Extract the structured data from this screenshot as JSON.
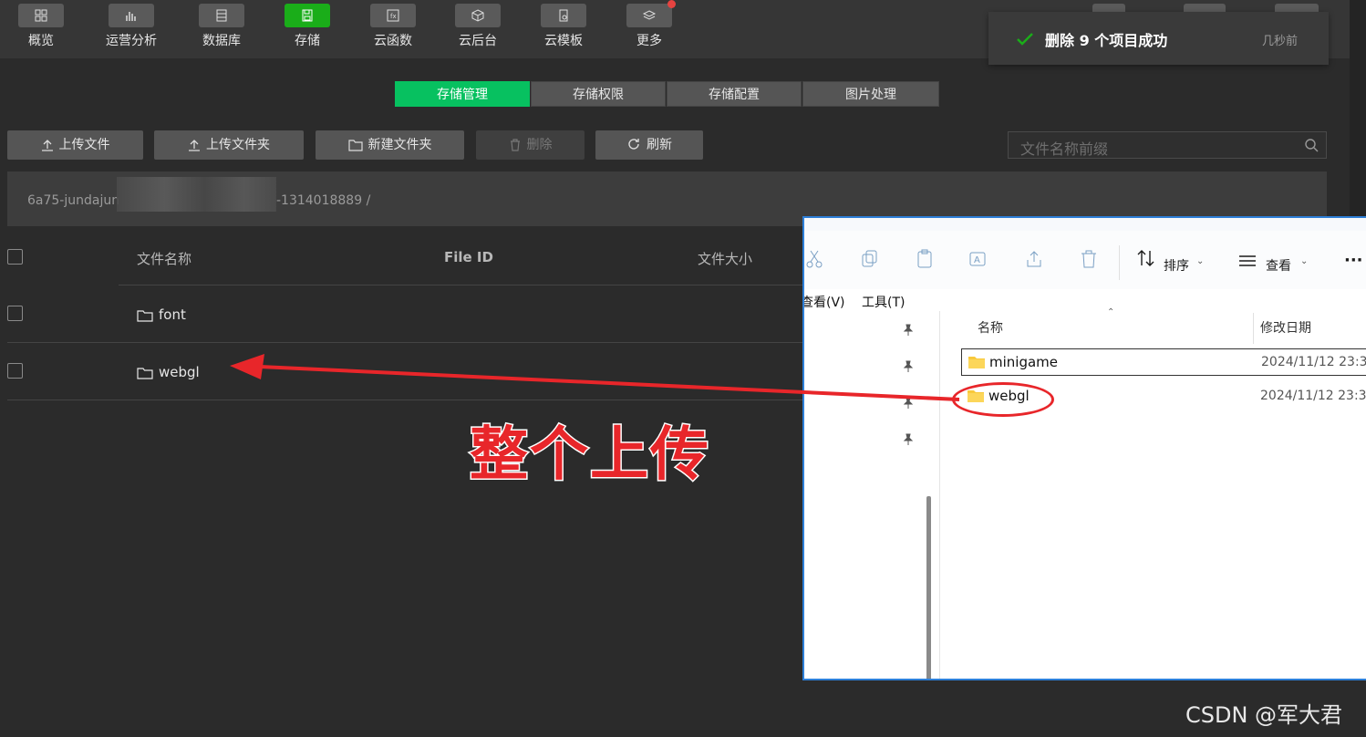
{
  "nav": {
    "items": [
      {
        "label": "概览",
        "icon": "grid-icon"
      },
      {
        "label": "运营分析",
        "icon": "bar-chart-icon"
      },
      {
        "label": "数据库",
        "icon": "database-icon"
      },
      {
        "label": "存储",
        "icon": "save-icon",
        "active": true
      },
      {
        "label": "云函数",
        "icon": "function-icon"
      },
      {
        "label": "云后台",
        "icon": "cube-icon"
      },
      {
        "label": "云模板",
        "icon": "template-icon"
      },
      {
        "label": "更多",
        "icon": "layers-icon"
      }
    ]
  },
  "toast": {
    "message": "删除 9 个项目成功",
    "time": "几秒前"
  },
  "tabs": [
    "存储管理",
    "存储权限",
    "存储配置",
    "图片处理"
  ],
  "toolbar": {
    "upload_file": "上传文件",
    "upload_folder": "上传文件夹",
    "new_folder": "新建文件夹",
    "delete": "删除",
    "refresh": "刷新"
  },
  "search": {
    "placeholder": "文件名称前缀"
  },
  "path": {
    "prefix": "6a75-jundajun",
    "suffix": "-1314018889  /"
  },
  "table": {
    "headers": {
      "name": "文件名称",
      "file_id": "File ID",
      "size": "文件大小"
    },
    "rows": [
      {
        "name": "font"
      },
      {
        "name": "webgl"
      }
    ]
  },
  "annotation": {
    "text": "整个上传"
  },
  "explorer": {
    "sort_label": "排序",
    "view_label": "查看",
    "more_label": "···",
    "menu": [
      "查看(V)",
      "工具(T)"
    ],
    "columns": {
      "name": "名称",
      "modified": "修改日期"
    },
    "rows": [
      {
        "name": "minigame",
        "date": "2024/11/12 23:3"
      },
      {
        "name": "webgl",
        "date": "2024/11/12 23:3"
      }
    ]
  },
  "watermark": "CSDN @军大君",
  "colors": {
    "accent": "#07c160",
    "annotation": "#e8262a",
    "background": "#2b2b2b"
  }
}
